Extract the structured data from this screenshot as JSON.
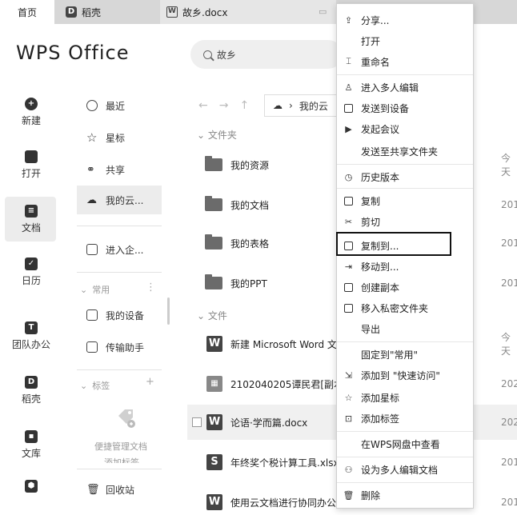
{
  "tabs": {
    "home": "首页",
    "wk": "稻壳",
    "doc": "故乡.docx"
  },
  "header": {
    "logo": "WPS Office",
    "search_value": "故乡"
  },
  "rail": {
    "new": "新建",
    "open": "打开",
    "docs": "文档",
    "calendar": "日历",
    "team": "团队办公",
    "wk": "稻壳",
    "library": "文库"
  },
  "sidebar": {
    "recent": "最近",
    "starred": "星标",
    "shared": "共享",
    "mycloud": "我的云...",
    "enterprise": "进入企...",
    "common_group": "常用",
    "my_device": "我的设备",
    "transfer": "传输助手",
    "tags_group": "标签",
    "tag_hint_1": "便捷管理文档",
    "tag_hint_2": "添加标签",
    "recycle": "回收站"
  },
  "files": {
    "path": "我的云",
    "folders_title": "文件夹",
    "files_title": "文件",
    "folders": [
      {
        "name": "我的资源",
        "date": "今天"
      },
      {
        "name": "我的文档",
        "date": "201"
      },
      {
        "name": "我的表格",
        "date": "201"
      },
      {
        "name": "我的PPT",
        "date": "201"
      }
    ],
    "items": [
      {
        "name": "新建 Microsoft Word 文",
        "date": "今天",
        "icon": "W"
      },
      {
        "name": "2102040205谭民君[副本",
        "date": "202",
        "icon": "▦"
      },
      {
        "name": "论语·学而篇.docx",
        "date": "202",
        "icon": "W"
      },
      {
        "name": "年终奖个税计算工具.xlsx",
        "date": "201",
        "icon": "S"
      },
      {
        "name": "使用云文档进行协同办公",
        "date": "201",
        "icon": "W"
      }
    ]
  },
  "menu": {
    "share": "分享...",
    "open": "打开",
    "rename": "重命名",
    "multi_edit": "进入多人编辑",
    "send_device": "发送到设备",
    "meeting": "发起会议",
    "send_shared": "发送至共享文件夹",
    "history": "历史版本",
    "copy": "复制",
    "cut": "剪切",
    "copy_to": "复制到...",
    "move_to": "移动到...",
    "duplicate": "创建副本",
    "move_private": "移入私密文件夹",
    "export": "导出",
    "pin_common": "固定到\"常用\"",
    "quick_access": "添加到  \"快速访问\"",
    "add_star": "添加星标",
    "add_tag": "添加标签",
    "view_wps_drive": "在WPS网盘中查看",
    "set_multi": "设为多人编辑文档",
    "delete": "删除"
  }
}
